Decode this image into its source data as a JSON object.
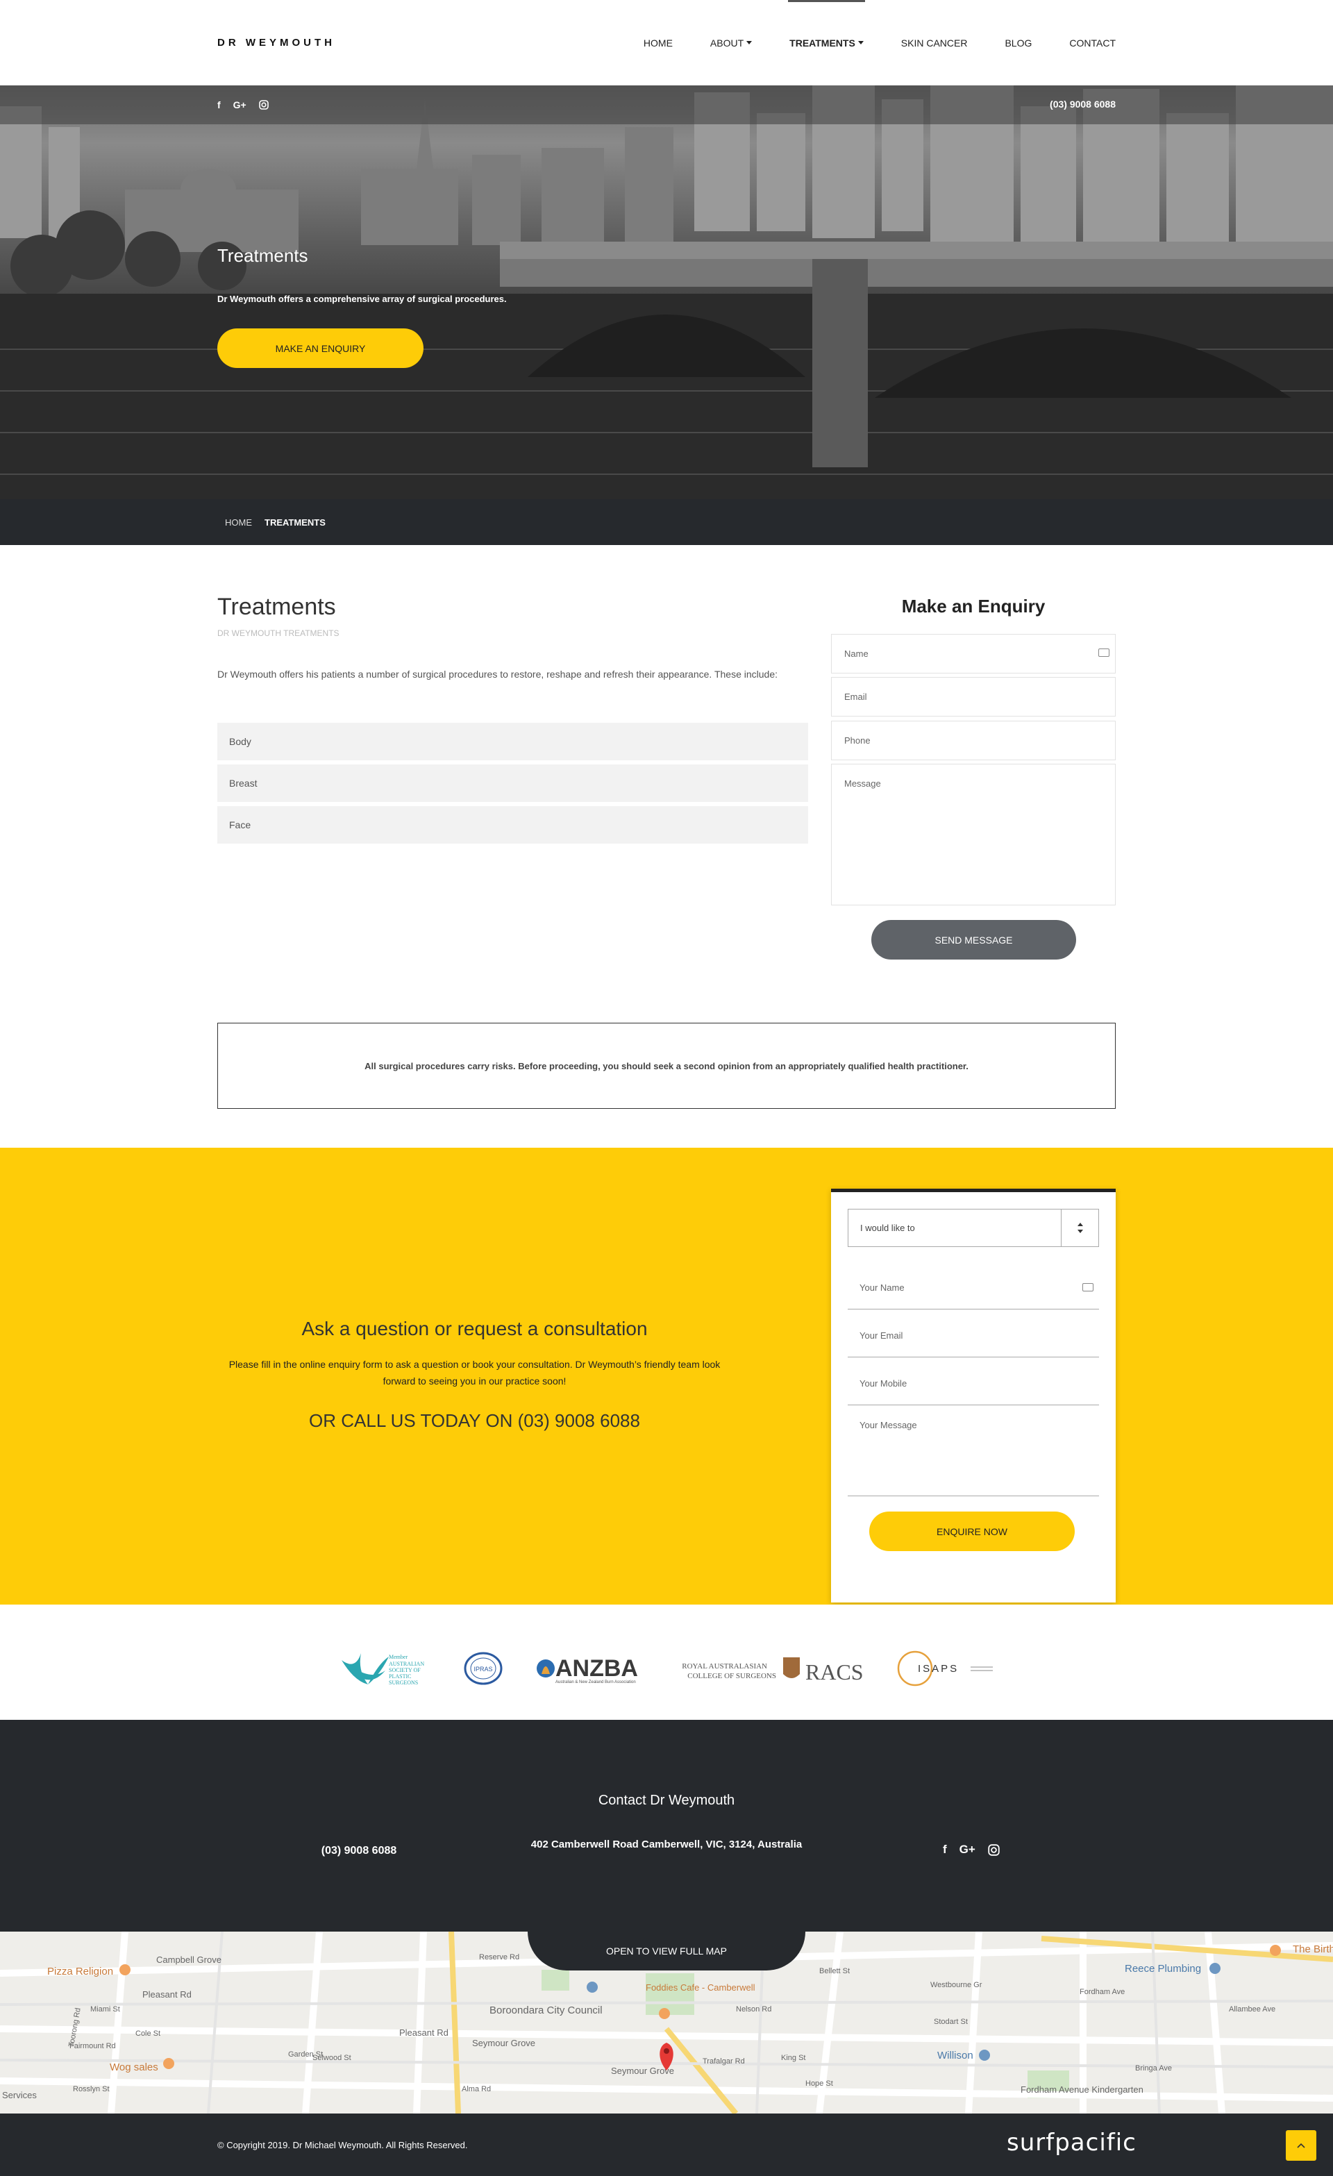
{
  "header": {
    "logo": "DR WEYMOUTH",
    "nav": [
      {
        "label": "HOME"
      },
      {
        "label": "ABOUT",
        "dropdown": true
      },
      {
        "label": "TREATMENTS",
        "dropdown": true,
        "active": true
      },
      {
        "label": "SKIN CANCER"
      },
      {
        "label": "BLOG"
      },
      {
        "label": "CONTACT"
      }
    ]
  },
  "topbar": {
    "social": [
      "facebook-icon",
      "google-plus-icon",
      "instagram-icon"
    ],
    "phone": "(03) 9008 6088"
  },
  "hero": {
    "title": "Treatments",
    "subtitle": "Dr Weymouth offers a comprehensive array of surgical procedures.",
    "button": "MAKE AN ENQUIRY"
  },
  "breadcrumb": {
    "home": "HOME",
    "current": "TREATMENTS"
  },
  "main": {
    "title": "Treatments",
    "subtitle": "DR WEYMOUTH TREATMENTS",
    "intro": "Dr Weymouth offers his patients a number of surgical procedures to restore, reshape and refresh their appearance. These include:",
    "treatments": [
      "Body",
      "Breast",
      "Face"
    ]
  },
  "enquiry": {
    "title": "Make an Enquiry",
    "name_placeholder": "Name",
    "email_placeholder": "Email",
    "phone_placeholder": "Phone",
    "message_placeholder": "Message",
    "send_button": "SEND MESSAGE"
  },
  "disclaimer": "All surgical procedures carry risks. Before proceeding, you should seek a second opinion from an appropriately qualified health practitioner.",
  "cta": {
    "title": "Ask a question or request a consultation",
    "text": "Please fill in the online enquiry form to ask a question or book your consultation. Dr Weymouth’s friendly team look forward to seeing you in our practice soon!",
    "call": "OR CALL US TODAY ON (03) 9008 6088",
    "form": {
      "select_value": "I would like to",
      "name_placeholder": "Your Name",
      "email_placeholder": "Your Email",
      "mobile_placeholder": "Your Mobile",
      "message_placeholder": "Your Message",
      "button": "ENQUIRE NOW"
    }
  },
  "logos": {
    "asps": {
      "lines": [
        "Member",
        "AUSTRALIAN",
        "SOCIETY OF",
        "PLASTIC",
        "SURGEONS"
      ]
    },
    "ipras": "IPRAS",
    "anzba": {
      "name": "ANZBA",
      "tagline": "Australian & New Zealand Burn Association"
    },
    "racs": {
      "line1": "ROYAL AUSTRALASIAN",
      "line2": "COLLEGE OF SURGEONS",
      "abbr": "RACS"
    },
    "isaps": "ISAPS"
  },
  "footer": {
    "title": "Contact Dr Weymouth",
    "phone": "(03) 9008 6088",
    "address": "402 Camberwell Road Camberwell, VIC, 3124, Australia",
    "social": [
      "facebook-icon",
      "google-plus-icon",
      "instagram-icon"
    ]
  },
  "map": {
    "tab": "OPEN TO VIEW FULL MAP",
    "labels": [
      "Campbell Grove",
      "Pizza Religion",
      "Pleasant Rd",
      "Miami St",
      "Cole St",
      "Fairmount Rd",
      "Toorong Rd",
      "Wog sales",
      "Services",
      "Rosslyn St",
      "Selwood St",
      "Garden St",
      "Pleasant Rd",
      "Reserve Rd",
      "Boroondara City Council",
      "Seymour Grove",
      "Alma Rd",
      "Foddies Cafe - Camberwell",
      "Trafalgar Rd",
      "Nelson Rd",
      "King St",
      "Hope St",
      "Seymour Grove",
      "Bellett St",
      "Westbourne Gr",
      "Stodart St",
      "Willison",
      "Reece Plumbing",
      "Allambee Ave",
      "Fordham Ave",
      "Fordham Avenue Kindergarten",
      "Bringa Ave",
      "The Birth"
    ]
  },
  "bottombar": {
    "copyright": "© Copyright 2019. Dr Michael Weymouth. All Rights Reserved.",
    "brand": "surfpacific"
  }
}
